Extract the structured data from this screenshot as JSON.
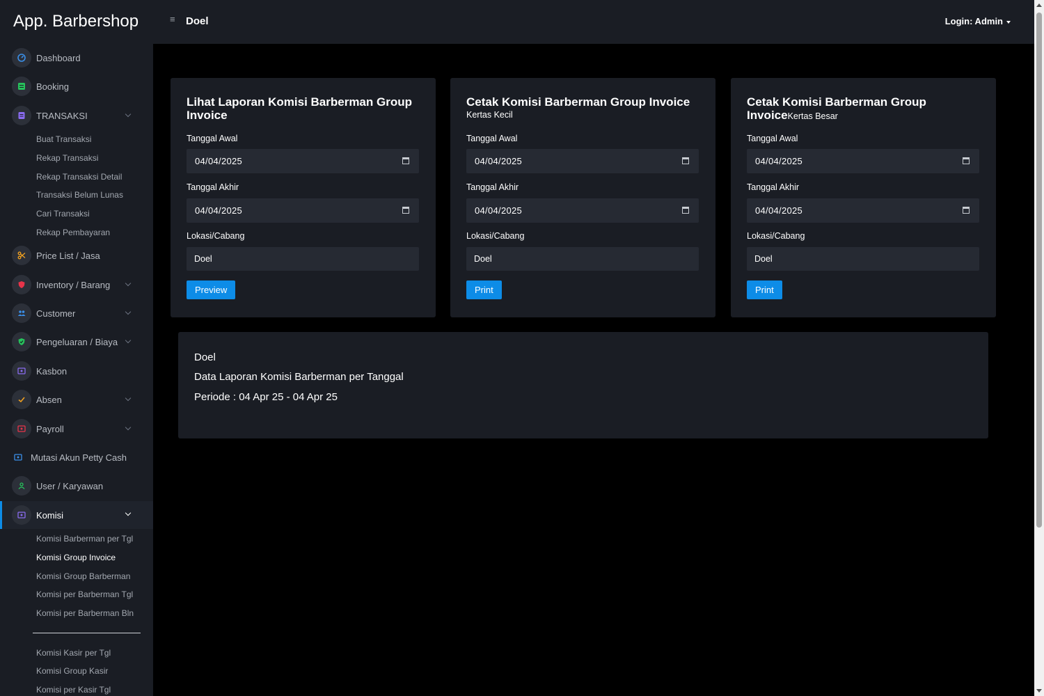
{
  "app": {
    "brand": "App. Barbershop",
    "page_title": "Doel",
    "login": "Login: Admin"
  },
  "sidebar": {
    "dashboard": "Dashboard",
    "booking": "Booking",
    "transaksi": "TRANSAKSI",
    "transaksi_subs": [
      "Buat Transaksi",
      "Rekap Transaksi",
      "Rekap Transaksi Detail",
      "Transaksi Belum Lunas",
      "Cari Transaksi",
      "Rekap Pembayaran"
    ],
    "price_list": "Price List / Jasa",
    "inventory": "Inventory / Barang",
    "customer": "Customer",
    "pengeluaran": "Pengeluaran / Biaya",
    "kasbon": "Kasbon",
    "absen": "Absen",
    "payroll": "Payroll",
    "mutasi": "Mutasi Akun Petty Cash",
    "user": "User / Karyawan",
    "komisi": "Komisi",
    "komisi_subs": [
      "Komisi Barberman per Tgl",
      "Komisi Group Invoice",
      "Komisi Group Barberman",
      "Komisi per Barberman Tgl",
      "Komisi per Barberman Bln"
    ],
    "komisi_kasir_subs": [
      "Komisi Kasir per Tgl",
      "Komisi Group Kasir",
      "Komisi per Kasir Tgl"
    ]
  },
  "cards": [
    {
      "title": "Lihat Laporan Komisi Barberman Group Invoice",
      "subtitle": "",
      "start_label": "Tanggal Awal",
      "start_value": "04/04/2025",
      "end_label": "Tanggal Akhir",
      "end_value": "04/04/2025",
      "location_label": "Lokasi/Cabang",
      "location_value": "Doel",
      "button": "Preview"
    },
    {
      "title": "Cetak Komisi Barberman Group Invoice",
      "subtitle": "Kertas Kecil",
      "start_label": "Tanggal Awal",
      "start_value": "04/04/2025",
      "end_label": "Tanggal Akhir",
      "end_value": "04/04/2025",
      "location_label": "Lokasi/Cabang",
      "location_value": "Doel",
      "button": "Print"
    },
    {
      "title": "Cetak Komisi Barberman Group Invoice",
      "subtitle": "Kertas Besar",
      "start_label": "Tanggal Awal",
      "start_value": "04/04/2025",
      "end_label": "Tanggal Akhir",
      "end_value": "04/04/2025",
      "location_label": "Lokasi/Cabang",
      "location_value": "Doel",
      "button": "Print"
    }
  ],
  "report": {
    "location": "Doel",
    "title": "Data Laporan Komisi Barberman per Tanggal",
    "period": "Periode : 04 Apr 25 - 04 Apr 25"
  },
  "icons": {
    "dashboard": "gauge-icon",
    "booking": "list-icon",
    "transaksi": "document-icon",
    "price_list": "scissors-icon",
    "inventory": "shield-icon",
    "customer": "users-icon",
    "pengeluaran": "shield-check-icon",
    "kasbon": "money-icon",
    "absen": "check-icon",
    "payroll": "money-icon",
    "mutasi": "money-icon",
    "user": "user-icon",
    "komisi": "money-icon"
  },
  "colors": {
    "accent": "#0d8ce7",
    "panel": "#1a1d24",
    "background": "#000000"
  }
}
